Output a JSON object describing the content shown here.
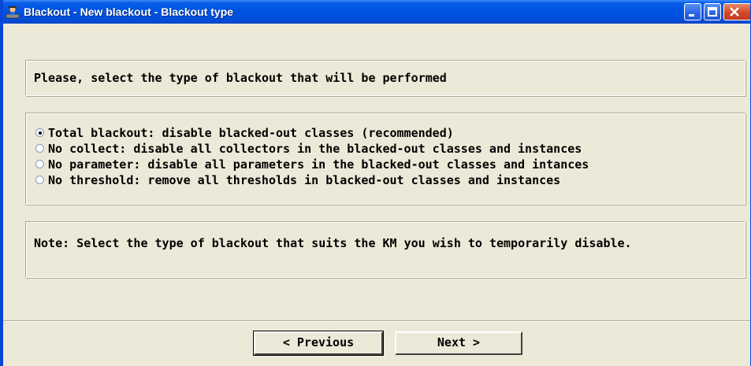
{
  "window": {
    "title": "Blackout - New blackout - Blackout type",
    "icon": "app-icon"
  },
  "header": {
    "text": "Please, select the type of blackout that will be performed"
  },
  "options": [
    {
      "label": "Total blackout: disable blacked-out classes (recommended)",
      "selected": true
    },
    {
      "label": "No collect: disable all collectors in the blacked-out classes and instances",
      "selected": false
    },
    {
      "label": "No parameter: disable all parameters in the blacked-out classes and intances",
      "selected": false
    },
    {
      "label": "No threshold: remove all thresholds in blacked-out classes and instances",
      "selected": false
    }
  ],
  "note": {
    "text": "Note: Select the type of blackout that suits the KM you wish to temporarily disable."
  },
  "buttons": {
    "previous": "< Previous",
    "next": "Next >"
  },
  "colors": {
    "titlebar": "#0054e3",
    "background": "#ece9d8",
    "close": "#d1492a"
  }
}
